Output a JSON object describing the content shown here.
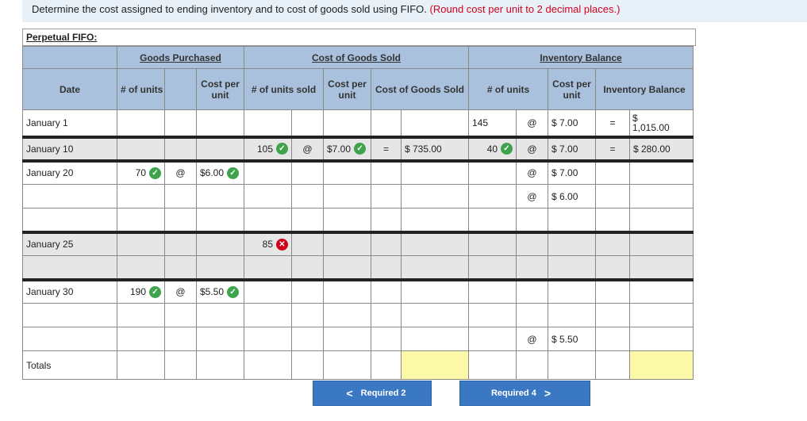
{
  "instruction": {
    "text": "Determine the cost assigned to ending inventory and to cost of goods sold using FIFO.",
    "note": "(Round cost per unit to 2 decimal places.)"
  },
  "section_title": "Perpetual FIFO:",
  "groups": {
    "purchased": "Goods Purchased",
    "cogs": "Cost of Goods Sold",
    "balance": "Inventory Balance"
  },
  "headers": {
    "date": "Date",
    "units": "# of units",
    "cost_per_unit": "Cost per unit",
    "units_sold": "# of units sold",
    "cogs_per_unit": "Cost per unit",
    "cogs_total": "Cost of Goods Sold",
    "bal_units": "# of units",
    "bal_cost": "Cost per unit",
    "inv_balance": "Inventory Balance"
  },
  "rows": {
    "jan1": {
      "date": "January 1",
      "bal_units": "145",
      "at": "@",
      "bal_cost": "$ 7.00",
      "eq": "=",
      "bal_dollar": "$",
      "bal_value": "1,015.00"
    },
    "jan10": {
      "date": "January 10",
      "units_sold": "105",
      "at": "@",
      "cogs_cost": "$7.00",
      "eq": "=",
      "cogs_total": "$ 735.00",
      "bal_units": "40",
      "bal_at": "@",
      "bal_cost": "$ 7.00",
      "bal_eq": "=",
      "bal_value": "$ 280.00"
    },
    "jan20": {
      "date": "January 20",
      "units": "70",
      "at": "@",
      "cost": "$6.00",
      "bal_at1": "@",
      "bal_cost1": "$ 7.00",
      "bal_at2": "@",
      "bal_cost2": "$ 6.00"
    },
    "jan25": {
      "date": "January 25",
      "units_sold": "85"
    },
    "jan30": {
      "date": "January 30",
      "units": "190",
      "at": "@",
      "cost": "$5.50",
      "bal_at": "@",
      "bal_cost": "$ 5.50"
    },
    "totals": {
      "date": "Totals"
    }
  },
  "buttons": {
    "prev": "Required 2",
    "next": "Required 4"
  },
  "colors": {
    "header": "#aac1dd",
    "check": "#3fa34d",
    "wrong": "#d0021b",
    "highlight": "#fbf9a8",
    "button": "#3a78c4"
  }
}
